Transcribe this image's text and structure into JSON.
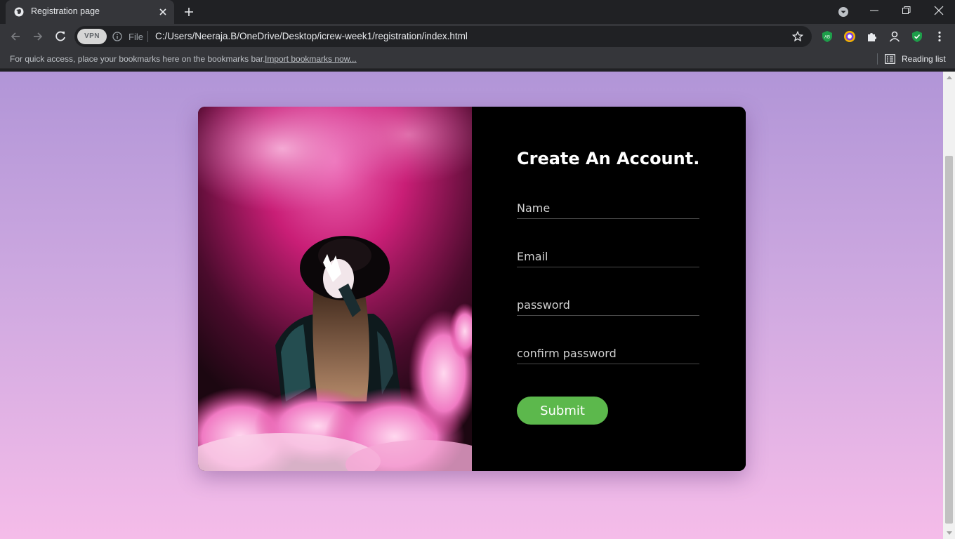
{
  "browser": {
    "tab_title": "Registration page",
    "file_label": "File",
    "url": "C:/Users/Neeraja.B/OneDrive/Desktop/icrew-week1/registration/index.html",
    "vpn_label": "VPN",
    "extensions": [
      "ab-icon",
      "multi-circle-icon",
      "puzzle-icon",
      "profile-icon",
      "shield-check-icon"
    ]
  },
  "bookmarks_bar": {
    "hint": "For quick access, place your bookmarks here on the bookmarks bar.",
    "import_link": "Import bookmarks now...",
    "reading_list": "Reading list"
  },
  "page": {
    "title": "Create An Account.",
    "fields": {
      "name_placeholder": "Name",
      "email_placeholder": "Email",
      "password_placeholder": "password",
      "confirm_placeholder": "confirm password"
    },
    "submit_label": "Submit",
    "colors": {
      "background_top": "#b195d7",
      "background_bottom": "#f5bce9",
      "panel": "#000000",
      "submit": "#5cb84c"
    }
  }
}
